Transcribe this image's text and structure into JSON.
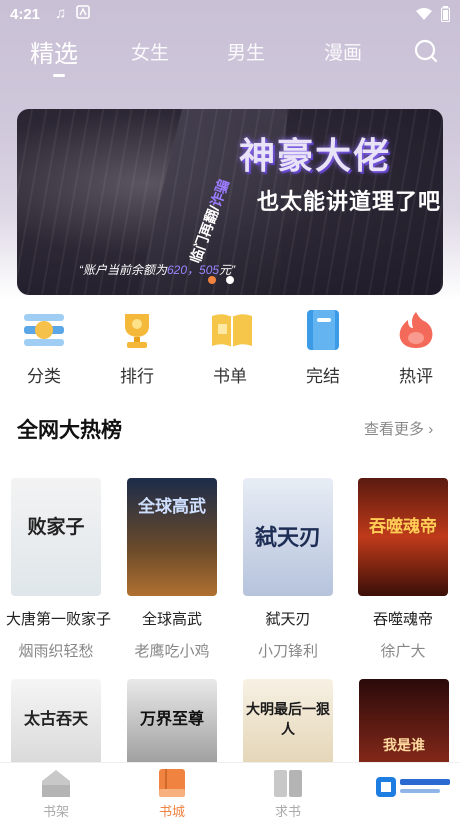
{
  "status": {
    "time": "4:21"
  },
  "tabs": [
    {
      "label": "精选",
      "active": true
    },
    {
      "label": "女生"
    },
    {
      "label": "男生"
    },
    {
      "label": "漫画"
    }
  ],
  "banner": {
    "title": "神豪大佬",
    "subtitle": "也太能讲道理了吧",
    "side_text_a": "临门再翻/",
    "side_text_b": "诈骗",
    "line_prefix": "“账户当前余额为",
    "line_amount": "620，505",
    "line_suffix": "元”"
  },
  "categories": [
    {
      "label": "分类",
      "icon": "category-icon",
      "color": "#5aa6e6"
    },
    {
      "label": "排行",
      "icon": "trophy-icon",
      "color": "#f4b93a"
    },
    {
      "label": "书单",
      "icon": "booklist-icon",
      "color": "#f6c64a"
    },
    {
      "label": "完结",
      "icon": "finished-icon",
      "color": "#3c9be6"
    },
    {
      "label": "热评",
      "icon": "hot-comment-icon",
      "color": "#f46a5a"
    }
  ],
  "section": {
    "title": "全网大热榜",
    "more": "查看更多"
  },
  "books": [
    {
      "title": "大唐第一败家子",
      "author": "烟雨织轻愁",
      "cover_text": "败家子"
    },
    {
      "title": "全球高武",
      "author": "老鹰吃小鸡",
      "cover_text": "全球高武"
    },
    {
      "title": "弑天刃",
      "author": "小刀锋利",
      "cover_text": "弑天刃"
    },
    {
      "title": "吞噬魂帝",
      "author": "徐广大",
      "cover_text": "吞噬魂帝"
    }
  ],
  "books_row2": [
    {
      "cover_text": "太古吞天"
    },
    {
      "cover_text": "万界至尊"
    },
    {
      "cover_text": "大明最后一狠人"
    },
    {
      "cover_text": "我是谁"
    }
  ],
  "bottom_nav": [
    {
      "label": "书架"
    },
    {
      "label": "书城",
      "active": true
    },
    {
      "label": "求书"
    }
  ],
  "colors": {
    "accent": "#f08340",
    "banner_purple": "#8b6cf0"
  }
}
